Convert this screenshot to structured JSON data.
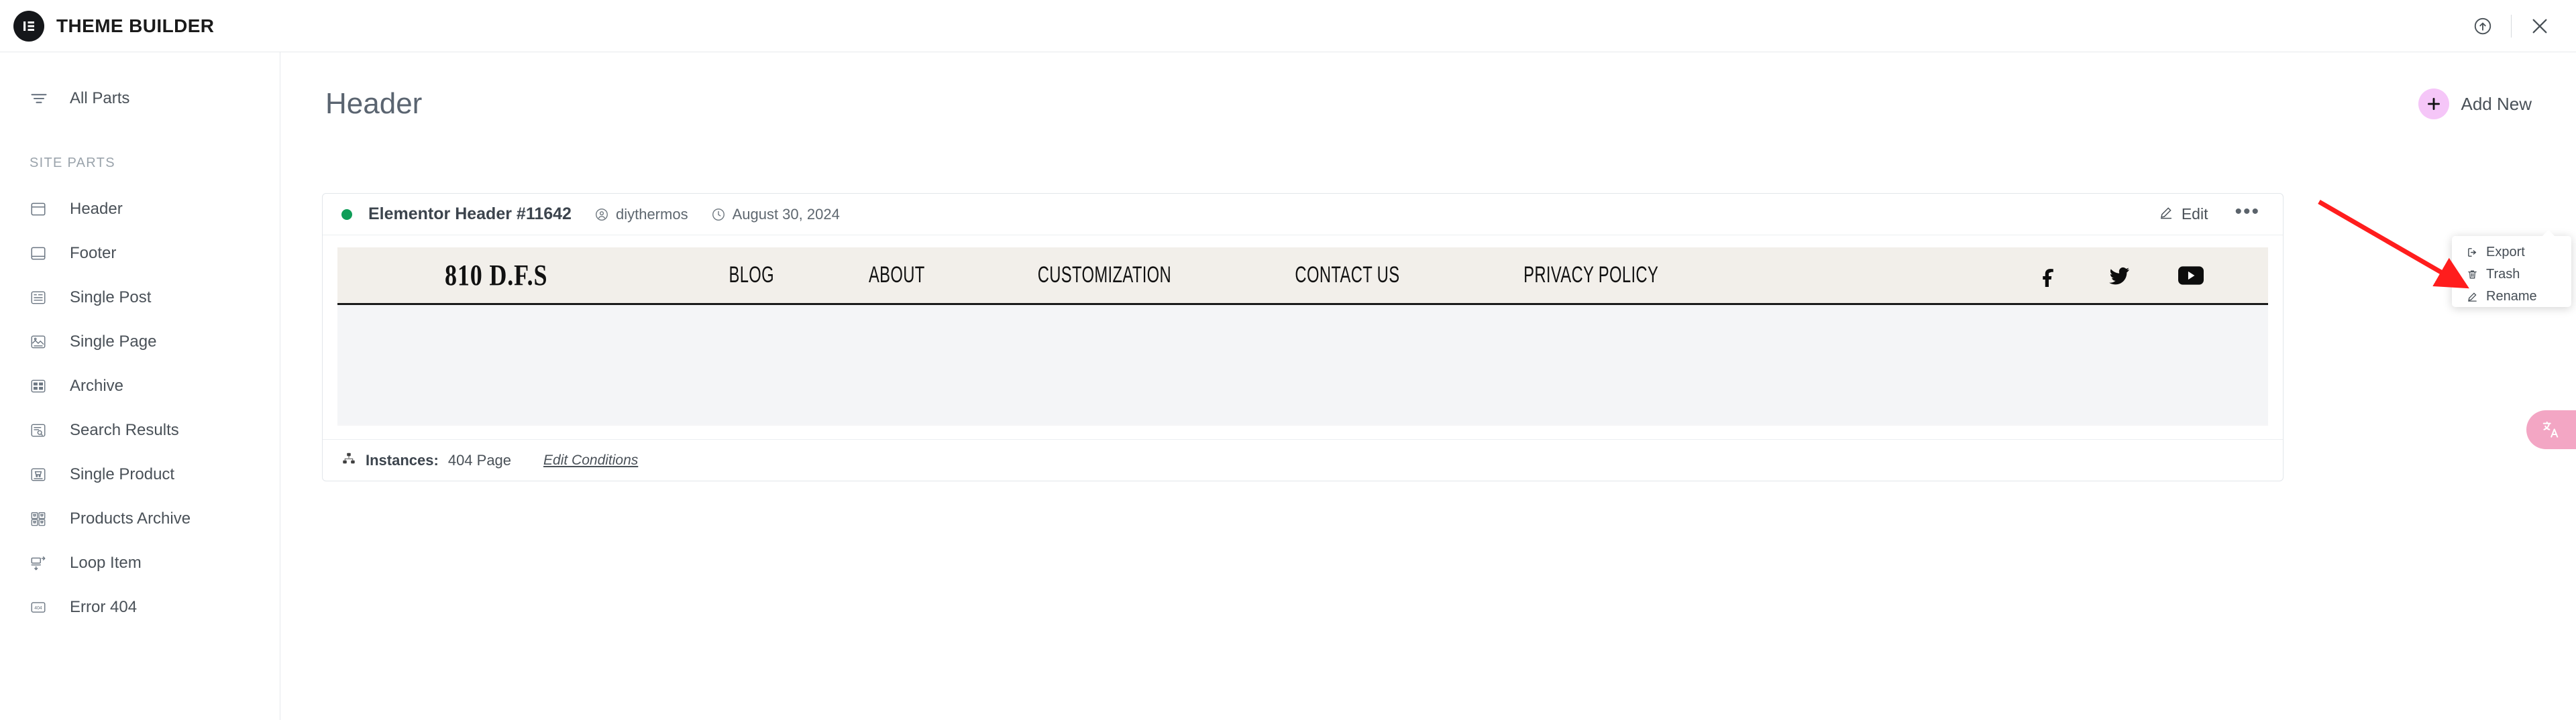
{
  "topbar": {
    "title": "THEME BUILDER",
    "logo_icon": "elementor-logo-icon",
    "help_icon": "help-circle-icon",
    "close_icon": "close-icon"
  },
  "sidebar": {
    "all_parts": {
      "label": "All Parts",
      "icon": "filter-icon"
    },
    "section_heading": "SITE PARTS",
    "items": [
      {
        "label": "Header",
        "icon": "header-layout-icon"
      },
      {
        "label": "Footer",
        "icon": "footer-layout-icon"
      },
      {
        "label": "Single Post",
        "icon": "single-post-icon"
      },
      {
        "label": "Single Page",
        "icon": "single-page-icon"
      },
      {
        "label": "Archive",
        "icon": "archive-grid-icon"
      },
      {
        "label": "Search Results",
        "icon": "search-results-icon"
      },
      {
        "label": "Single Product",
        "icon": "single-product-icon"
      },
      {
        "label": "Products Archive",
        "icon": "products-archive-icon"
      },
      {
        "label": "Loop Item",
        "icon": "loop-item-icon"
      },
      {
        "label": "Error 404",
        "icon": "error-404-icon"
      }
    ]
  },
  "main": {
    "page_title": "Header",
    "add_new_label": "Add New",
    "add_new_icon": "plus-icon",
    "accent_pink": "#f5c6f8"
  },
  "card": {
    "status_color": "#0f9d58",
    "name": "Elementor Header #11642",
    "author": "diythermos",
    "author_icon": "user-circle-icon",
    "date": "August 30, 2024",
    "date_icon": "clock-icon",
    "edit_label": "Edit",
    "edit_icon": "pencil-icon",
    "more_icon": "ellipsis-icon",
    "more_label": "•••",
    "instances_label": "Instances:",
    "instances_value": "404 Page",
    "instances_icon": "sitemap-icon",
    "edit_conditions_label": "Edit Conditions"
  },
  "preview": {
    "logo_text": "810 D.F.S",
    "nav": [
      "BLOG",
      "ABOUT",
      "CUSTOMIZATION",
      "CONTACT US",
      "PRIVACY POLICY"
    ],
    "social": [
      "facebook-icon",
      "twitter-icon",
      "youtube-icon"
    ],
    "bar_bg": "#f2efea"
  },
  "dropdown": {
    "items": [
      {
        "label": "Export",
        "icon": "export-icon"
      },
      {
        "label": "Trash",
        "icon": "trash-icon"
      },
      {
        "label": "Rename",
        "icon": "pencil-icon"
      }
    ]
  },
  "annotation": {
    "arrow_color": "#ff1d1d",
    "points_to": "Trash"
  },
  "translate_widget": {
    "icon": "translate-icon",
    "color": "#f3a6c4"
  }
}
